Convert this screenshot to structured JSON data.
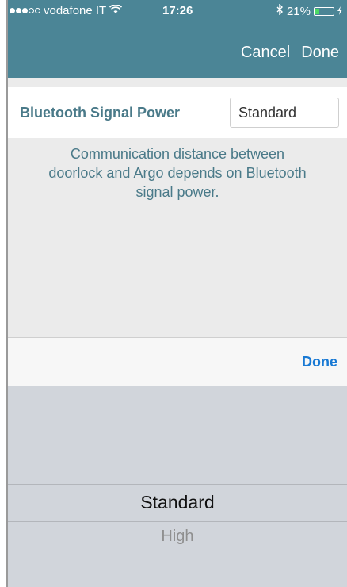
{
  "status_bar": {
    "carrier": "vodafone IT",
    "time": "17:26",
    "battery": "21%",
    "battery_level": 0.21,
    "signal_strength": "3 of 5",
    "icons": [
      "wifi-icon",
      "bluetooth-icon",
      "battery-icon"
    ]
  },
  "nav": {
    "cancel": "Cancel",
    "done": "Done"
  },
  "form": {
    "label": "Bluetooth Signal Power",
    "value": "Standard",
    "description_lines": [
      "Communication distance between",
      "doorlock and Argo depends on Bluetooth",
      "signal power."
    ]
  },
  "accessory": {
    "done": "Done"
  },
  "picker": {
    "selected": "Standard",
    "next": "High"
  },
  "colors": {
    "header": "#4b8596",
    "label": "#4a7a89",
    "accent": "#1a7ad4",
    "picker_bg": "#d1d5db"
  }
}
